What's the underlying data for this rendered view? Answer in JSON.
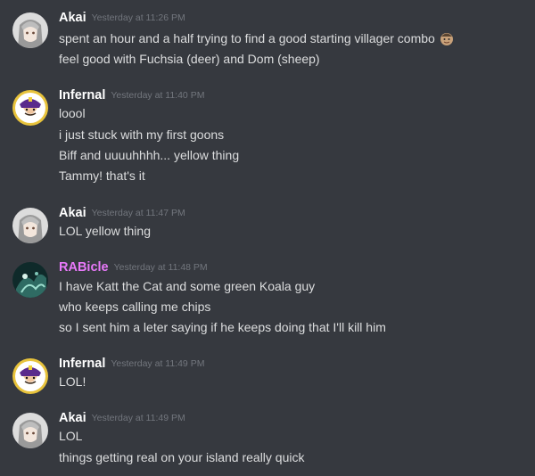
{
  "chat": {
    "groups": [
      {
        "username": "Akai",
        "timestamp": "Yesterday at 11:26 PM",
        "avatar": "anime-girl-avatar",
        "name_color": "#ffffff",
        "lines": [
          "spent an hour and a half trying to find a good starting villager combo",
          "feel good with Fuchsia (deer) and Dom (sheep)"
        ],
        "emoji": "villager-emoji"
      },
      {
        "username": "Infernal",
        "timestamp": "Yesterday at 11:40 PM",
        "avatar": "waluigi-avatar",
        "name_color": "#ffffff",
        "lines": [
          "loool",
          "i just stuck with my first goons",
          "Biff and uuuuhhhh... yellow thing",
          "Tammy! that's it"
        ]
      },
      {
        "username": "Akai",
        "timestamp": "Yesterday at 11:47 PM",
        "avatar": "anime-girl-avatar",
        "name_color": "#ffffff",
        "lines": [
          "LOL yellow thing"
        ]
      },
      {
        "username": "RABicle",
        "timestamp": "Yesterday at 11:48 PM",
        "avatar": "dark-teal-avatar",
        "name_color": "#e879f9",
        "lines": [
          "I have Katt the Cat and some green Koala guy",
          "who keeps calling me chips",
          "so I sent him a leter saying if he keeps doing that I'll kill him"
        ]
      },
      {
        "username": "Infernal",
        "timestamp": "Yesterday at 11:49 PM",
        "avatar": "waluigi-avatar",
        "name_color": "#ffffff",
        "lines": [
          "LOL!"
        ]
      },
      {
        "username": "Akai",
        "timestamp": "Yesterday at 11:49 PM",
        "avatar": "anime-girl-avatar",
        "name_color": "#ffffff",
        "lines": [
          "LOL",
          "things getting real on your island really quick"
        ]
      }
    ]
  }
}
